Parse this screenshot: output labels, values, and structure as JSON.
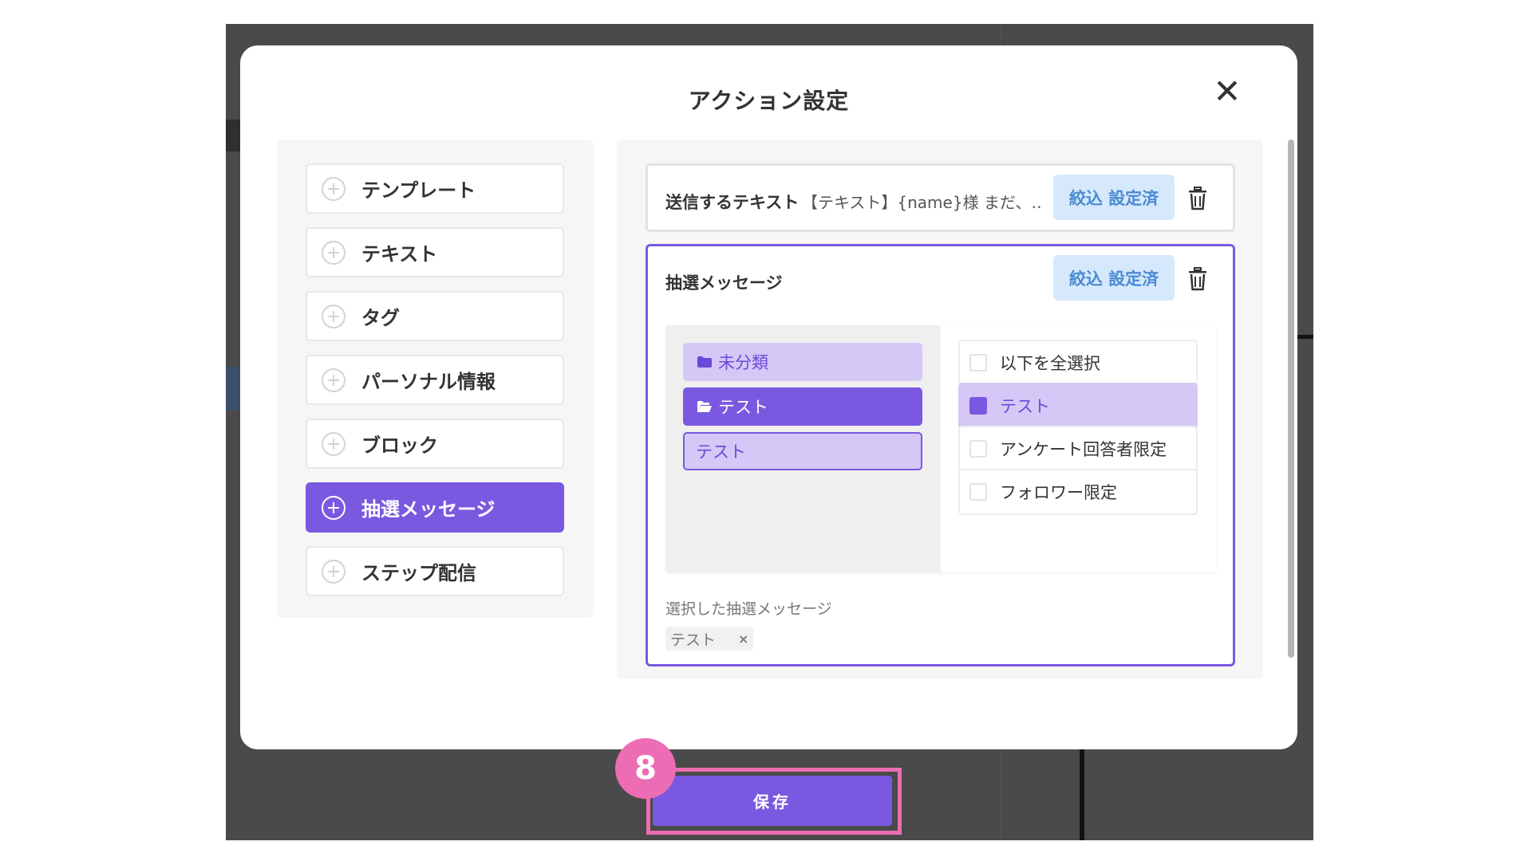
{
  "modal": {
    "title": "アクション設定",
    "close_glyph": "✕"
  },
  "menu": {
    "items": [
      {
        "label": "テンプレート",
        "active": false
      },
      {
        "label": "テキスト",
        "active": false
      },
      {
        "label": "タグ",
        "active": false
      },
      {
        "label": "パーソナル情報",
        "active": false
      },
      {
        "label": "ブロック",
        "active": false
      },
      {
        "label": "抽選メッセージ",
        "active": true
      },
      {
        "label": "ステップ配信",
        "active": false
      }
    ]
  },
  "send_text": {
    "label": "送信するテキスト",
    "preview": "【テキスト】{name}様 まだ、…",
    "filter_label": "絞込 設定済"
  },
  "lottery": {
    "title": "抽選メッセージ",
    "filter_label": "絞込 設定済",
    "folders": [
      {
        "label": "未分類",
        "icon": "folder-closed-icon"
      },
      {
        "label": "テスト",
        "icon": "folder-open-icon"
      },
      {
        "label": "テスト",
        "icon": ""
      }
    ],
    "options": [
      {
        "label": "以下を全選択",
        "checked": false
      },
      {
        "label": "テスト",
        "checked": true
      },
      {
        "label": "アンケート回答者限定",
        "checked": false
      },
      {
        "label": "フォロワー限定",
        "checked": false
      }
    ],
    "selected_label": "選択した抽選メッセージ",
    "selected_chip": "テスト",
    "chip_remove": "×"
  },
  "footer": {
    "save_label": "保存",
    "step_number": "8"
  },
  "colors": {
    "accent": "#7a59e0",
    "accent_light": "#d5c8f6",
    "filter_bg": "#d6e8fb",
    "filter_text": "#4b8ad3",
    "highlight": "#ec6db3"
  }
}
